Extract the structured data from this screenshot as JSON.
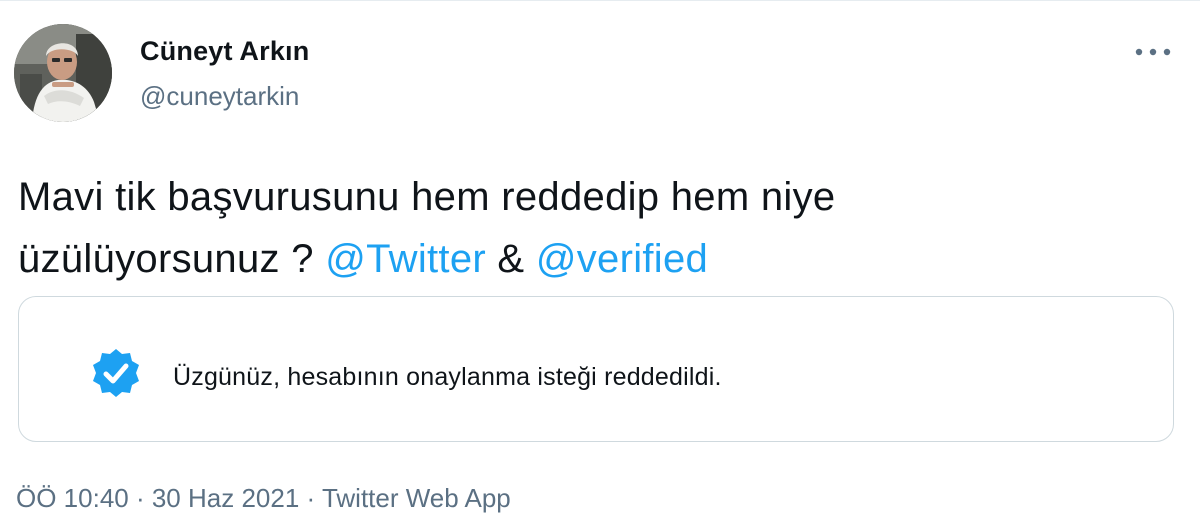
{
  "user": {
    "name": "Cüneyt Arkın",
    "handle": "@cuneytarkin"
  },
  "tweet": {
    "text_line1": "Mavi tik başvurusunu hem reddedip hem niye",
    "text_line2_prefix": "üzülüyorsunuz ? ",
    "mention1": "@Twitter",
    "ampersand": " & ",
    "mention2": "@verified"
  },
  "notice": {
    "text": "Üzgünüz, hesabının onaylanma isteği reddedildi.",
    "icon": "verified-badge-icon",
    "badge_color": "#1da1f2"
  },
  "meta": {
    "time": "ÖÖ 10:40",
    "separator": " · ",
    "date": "30 Haz 2021",
    "source": "Twitter Web App"
  },
  "colors": {
    "accent": "#1da1f2",
    "muted": "#5b7083",
    "border": "#cfd9de"
  }
}
